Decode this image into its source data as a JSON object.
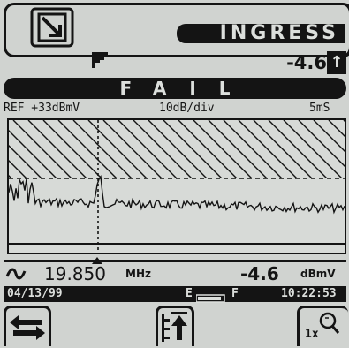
{
  "header": {
    "mode_icon": "no-entry-arrow-icon",
    "title": "INGRESS",
    "filter_icon": "step-level-icon",
    "reading_value": "-4.6",
    "up_arrow": "↑"
  },
  "result": {
    "status": "FAIL"
  },
  "scale": {
    "ref": "REF +33dBmV",
    "div": "10dB/div",
    "sweep": "5mS"
  },
  "marker": {
    "icon": "wave-icon",
    "frequency": "19.850",
    "frequency_unit": "MHz",
    "level": "-4.6",
    "level_unit": "dBmV"
  },
  "status_bar": {
    "date": "04/13/99",
    "battery_empty": "E",
    "battery_full": "F",
    "time": "10:22:53"
  },
  "softkeys": {
    "left_icon": "marker-shift-icon",
    "center_icon": "peak-hold-icon",
    "center_label": "↑",
    "right_icon": "zoom-icon",
    "right_label": "1x"
  }
}
